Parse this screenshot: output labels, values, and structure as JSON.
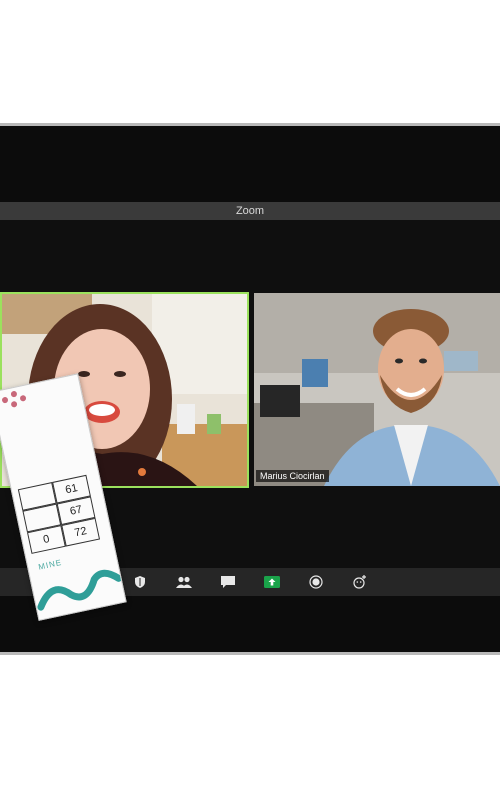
{
  "window": {
    "title": "Zoom"
  },
  "participants": [
    {
      "name": ""
    },
    {
      "name": "Marius Ciocirlan"
    }
  ],
  "toolbar": {
    "buttons": [
      "security-icon",
      "participants-icon",
      "chat-icon",
      "share-screen-icon",
      "record-icon",
      "reactions-icon"
    ]
  },
  "card": {
    "numbers": [
      "61",
      "67",
      "0",
      "72"
    ],
    "word": "MINE"
  },
  "colors": {
    "active_speaker": "#9be15d",
    "share_button": "#1aa34a"
  }
}
